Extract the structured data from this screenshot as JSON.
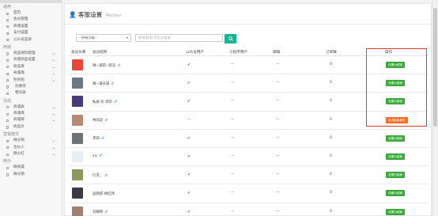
{
  "page": {
    "title": "客服设置",
    "subtitle": "Member"
  },
  "sidebar": {
    "sections": [
      {
        "title": "通用",
        "items": [
          {
            "label": "首页",
            "chevron": false
          },
          {
            "label": "会员管理",
            "chevron": false
          },
          {
            "label": "商城设置",
            "chevron": false
          },
          {
            "label": "支付设置",
            "chevron": false
          },
          {
            "label": "公众号菜单",
            "chevron": false
          }
        ]
      },
      {
        "title": "商城",
        "items": [
          {
            "label": "商品资料管理",
            "chevron": true
          },
          {
            "label": "商城商品设置",
            "chevron": true
          },
          {
            "label": "商品库",
            "chevron": true
          },
          {
            "label": "商城库",
            "chevron": true
          },
          {
            "label": "秒杀购",
            "chevron": true
          },
          {
            "label": "优惠券",
            "chevron": false,
            "sub": true
          },
          {
            "label": "物流表",
            "chevron": false,
            "sub": true
          }
        ]
      },
      {
        "title": "活动",
        "items": [
          {
            "label": "商城表",
            "chevron": true
          },
          {
            "label": "商城库",
            "chevron": true
          },
          {
            "label": "商城库",
            "chevron": true
          },
          {
            "label": "商品价",
            "chevron": false
          }
        ]
      },
      {
        "title": "营销模式",
        "items": [
          {
            "label": "微分销",
            "chevron": true
          },
          {
            "label": "合伙人",
            "chevron": true
          },
          {
            "label": "微分红",
            "chevron": true
          }
        ]
      },
      {
        "title": "微分",
        "items": [
          {
            "label": "微商城",
            "chevron": false
          },
          {
            "label": "微分销",
            "chevron": false
          }
        ]
      }
    ]
  },
  "filters": {
    "level_select": "--所有分级--",
    "search_placeholder": "昵称/姓名/手机号查询",
    "search_button_icon": "search-icon"
  },
  "table": {
    "headers": [
      "会员头像",
      "会员昵称",
      "公众号用户",
      "小程序用户",
      "邮箱",
      "订单数",
      "操作"
    ],
    "rows": [
      {
        "nickname": "晴~满苗~筑东",
        "gender": "♂",
        "public": true,
        "mini": false,
        "email": "—",
        "orders": "0",
        "action": "设置为客服",
        "action_style": "green",
        "avatar_color": "#e8473a"
      },
      {
        "nickname": "晴~满天城",
        "gender": "♂",
        "public": true,
        "mini": false,
        "email": "—",
        "orders": "0",
        "action": "设置为客服",
        "action_style": "green",
        "avatar_color": "#6a7888"
      },
      {
        "nickname": "私采-珩 玥华",
        "gender": "♂",
        "public": true,
        "mini": false,
        "email": "—",
        "orders": "0",
        "action": "设置为客服",
        "action_style": "green",
        "avatar_color": "#4a3c7a"
      },
      {
        "nickname": "林凤良",
        "gender": "♂",
        "public": false,
        "mini": false,
        "email": "—",
        "orders": "0",
        "action": "取消客服身份",
        "action_style": "orange",
        "avatar_color": "#b88a74"
      },
      {
        "nickname": "李四",
        "gender": "♂",
        "public": true,
        "mini": false,
        "email": "—",
        "orders": "0",
        "action": "设置为客服",
        "action_style": "green",
        "avatar_color": "#6e7475"
      },
      {
        "nickname": "vic",
        "gender": "♂",
        "public": true,
        "mini": false,
        "email": "—",
        "orders": "0",
        "action": "设置为客服",
        "action_style": "green",
        "avatar_color": "#e9eef2"
      },
      {
        "nickname": "行李。",
        "gender": "♂",
        "public": true,
        "mini": false,
        "email": "—",
        "orders": "0",
        "action": "设置为客服",
        "action_style": "green",
        "avatar_color": "#8a9a5a"
      },
      {
        "nickname": "品牌部-胡红伟",
        "gender": "",
        "public": true,
        "mini": false,
        "email": "—",
        "orders": "0",
        "action": "设置为客服",
        "action_style": "green",
        "avatar_color": "#3a3a44"
      },
      {
        "nickname": "刘耀明",
        "gender": "♂",
        "public": true,
        "mini": false,
        "email": "—",
        "orders": "0",
        "action": "设置为客服",
        "action_style": "green",
        "avatar_color": "#a08070"
      }
    ]
  },
  "colors": {
    "accent": "#1ab394",
    "action_green": "#3aa83a",
    "action_orange": "#f26c2c",
    "highlight": "#e23b2e"
  }
}
